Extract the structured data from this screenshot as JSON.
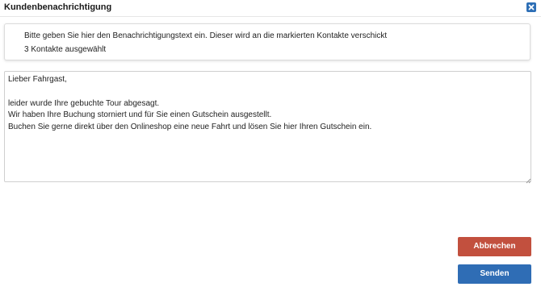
{
  "dialog": {
    "title": "Kundenbenachrichtigung",
    "close_icon": "close-icon"
  },
  "info": {
    "instruction": "Bitte geben Sie hier den Benachrichtigungstext ein. Dieser wird an die markierten Kontakte verschickt",
    "selected_count": "3 Kontakte ausgewählt"
  },
  "message": {
    "value": "Lieber Fahrgast,\n\nleider wurde Ihre gebuchte Tour abgesagt.\nWir haben Ihre Buchung storniert und für Sie einen Gutschein ausgestellt.\nBuchen Sie gerne direkt über den Onlineshop eine neue Fahrt und lösen Sie hier Ihren Gutschein ein."
  },
  "buttons": {
    "cancel_label": "Abbrechen",
    "send_label": "Senden"
  },
  "colors": {
    "accent_blue": "#2f6db5",
    "cancel_red": "#c2503e",
    "close_blue": "#2e6fb6"
  }
}
